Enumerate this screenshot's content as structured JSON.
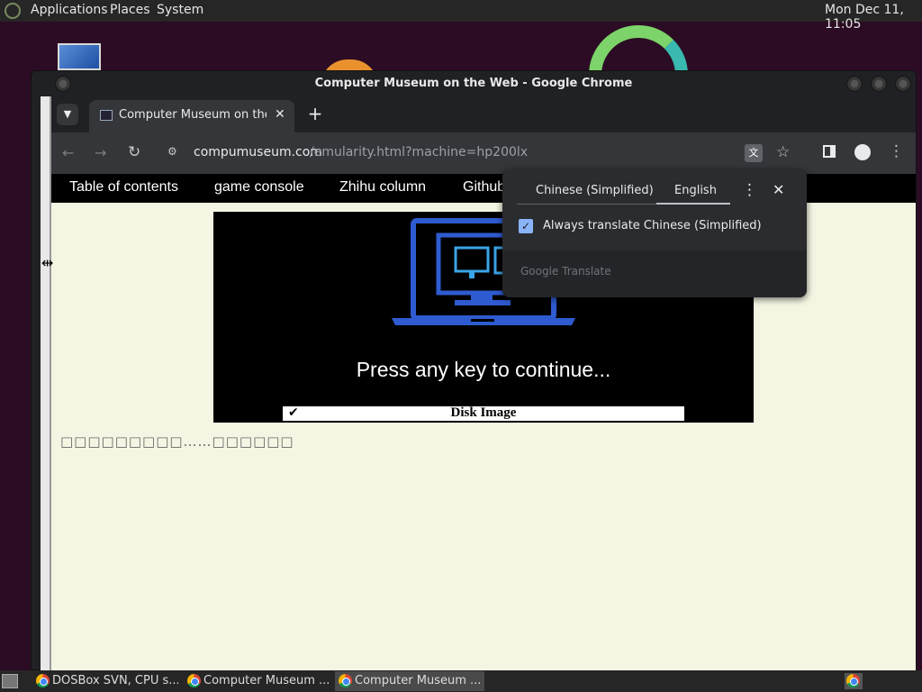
{
  "topbar": {
    "menus": [
      "Applications",
      "Places",
      "System"
    ],
    "clock": "Mon Dec 11, 11:05"
  },
  "window": {
    "title": "Computer Museum on the Web - Google Chrome"
  },
  "browser": {
    "tab_title": "Computer Museum on the W",
    "url_domain": "compumuseum.com",
    "url_path": "/emularity.html?machine=hp200lx"
  },
  "site": {
    "nav": [
      "Table of contents",
      "game console",
      "Zhihu column",
      "Github"
    ],
    "emulator_message": "Press any key to continue...",
    "disk_check": "✔",
    "disk_label": "Disk Image",
    "body_text": "□□□□□□□□□……□□□□□□"
  },
  "translate_popup": {
    "source_lang": "Chinese (Simplified)",
    "target_lang": "English",
    "always_translate_label": "Always translate Chinese (Simplified)",
    "always_translate_checked": true,
    "footer": "Google Translate"
  },
  "taskbar": {
    "items": [
      "DOSBox SVN, CPU s...",
      "Computer Museum ...",
      "Computer Museum ..."
    ]
  },
  "colors": {
    "desktop_bg": "#2c0c24",
    "chrome_dark": "#202124",
    "toolbar": "#35363a",
    "page_bg": "#f5f5e3",
    "monitor_blue": "#2f5bd1",
    "checkbox_blue": "#8ab4f8"
  },
  "icons": [
    "gnome-foot-icon",
    "dropdown-icon",
    "close-icon",
    "plus-icon",
    "back-icon",
    "forward-icon",
    "reload-icon",
    "site-info-icon",
    "translate-icon",
    "star-icon",
    "side-panel-icon",
    "profile-icon",
    "menu-icon",
    "show-desktop-icon",
    "chrome-icon"
  ]
}
